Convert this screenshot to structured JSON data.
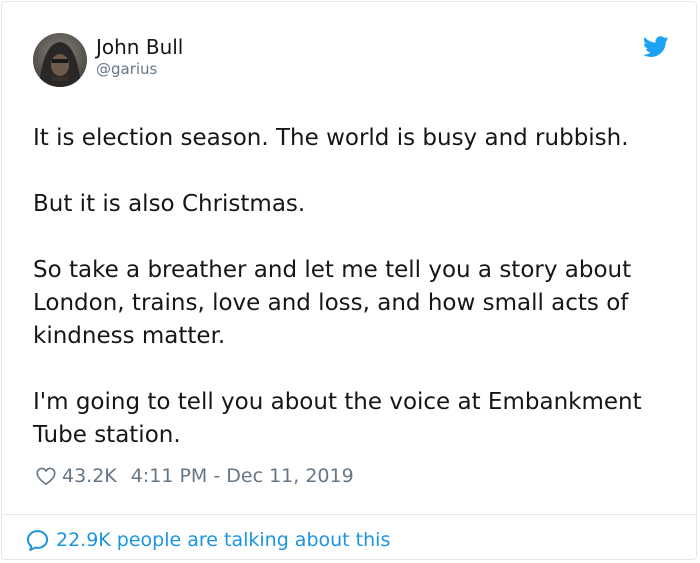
{
  "tweet": {
    "author": {
      "name": "John Bull",
      "handle": "@garius"
    },
    "paragraphs": [
      "It is election season. The world is busy and rubbish.",
      "But it is also Christmas.",
      "So take a breather and let me tell you a story about London, trains, love and loss, and how small acts of kindness matter.",
      "I'm going to tell you about the voice at Embankment Tube station."
    ],
    "likes": "43.2K",
    "timestamp": "4:11 PM - Dec 11, 2019"
  },
  "footer": {
    "talking": "22.9K people are talking about this"
  },
  "icons": {
    "brand": "twitter-bird-icon",
    "like": "heart-icon",
    "talk": "speech-bubble-icon"
  },
  "colors": {
    "brand_blue": "#1da1f2",
    "link_blue": "#1b95e0",
    "text": "#14171a",
    "muted": "#657786",
    "border": "#e1e8ed"
  }
}
